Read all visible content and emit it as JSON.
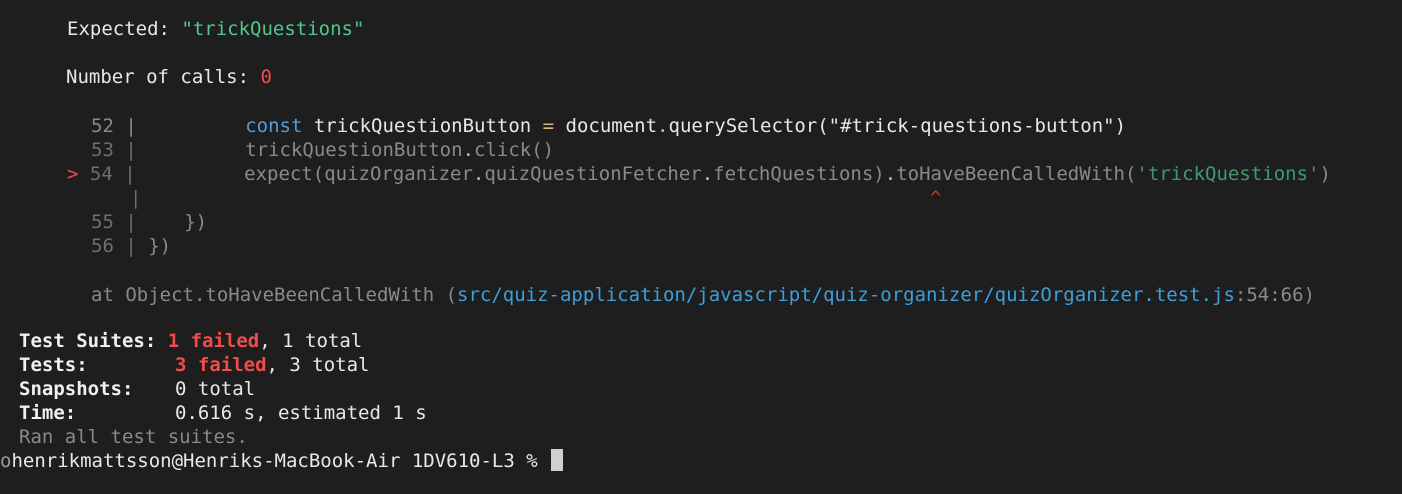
{
  "expected": {
    "label": "Expected: ",
    "value": "\"trickQuestions\""
  },
  "calls": {
    "label": "Number of calls: ",
    "value": "0"
  },
  "code": {
    "l52": {
      "num": "52",
      "kw": "const",
      "a": " trickQuestionButton ",
      "eq": "=",
      "b": " document",
      "dot": ".",
      "c": "querySelector(\"#trick-questions-button\")"
    },
    "l53": {
      "num": "53",
      "a": "trickQuestionButton",
      "dot": ".",
      "b": "click()"
    },
    "l54": {
      "marker": ">",
      "num": "54",
      "a": "expect(quizOrganizer",
      "d1": ".",
      "b": "quizQuestionFetcher",
      "d2": ".",
      "c": "fetchQuestions)",
      "d3": ".",
      "d": "toHaveBeenCalledWith(",
      "s": "'trickQuestions'",
      "e": ")"
    },
    "caret": "^",
    "l55": {
      "num": "55",
      "a": "})"
    },
    "l56": {
      "num": "56",
      "a": "})"
    }
  },
  "stack": {
    "at": "at Object.toHaveBeenCalledWith (",
    "path": "src/quiz-application/javascript/quiz-organizer/quizOrganizer.test.js",
    "loc": ":54:66)"
  },
  "summary": {
    "suites": {
      "label": "Test Suites:",
      "failed": "1 failed",
      "total": ", 1 total"
    },
    "tests": {
      "label": "Tests:",
      "failed": "3 failed",
      "total": ", 3 total"
    },
    "snapshots": {
      "label": "Snapshots:",
      "value": "0 total"
    },
    "time": {
      "label": "Time:",
      "value": "0.616 s, estimated 1 s"
    },
    "ran": "Ran all test suites."
  },
  "prompt": {
    "dot": "o",
    "text": "henrikmattsson@Henriks-MacBook-Air 1DV610-L3 % "
  }
}
